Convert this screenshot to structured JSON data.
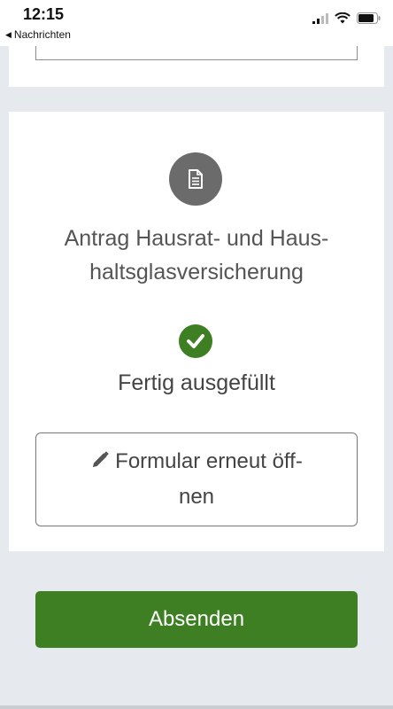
{
  "status_bar": {
    "time": "12:15",
    "back_label": "Nachrichten",
    "icons": [
      "cellular-signal-icon",
      "wifi-icon",
      "battery-icon"
    ]
  },
  "document_card": {
    "icon": "document-icon",
    "title": "Antrag Hausrat- und Haus-\nhaltsglasversicherung",
    "status_icon": "check-circle-icon",
    "status_text": "Fertig ausgefüllt",
    "reopen_button": {
      "icon": "pencil-icon",
      "label": "Formular erneut öff-\nnen"
    }
  },
  "submit_button": {
    "label": "Absenden"
  },
  "colors": {
    "accent_green": "#3d7f22",
    "doc_icon_bg": "#6b6b6b",
    "page_bg": "#e6e9ee"
  }
}
